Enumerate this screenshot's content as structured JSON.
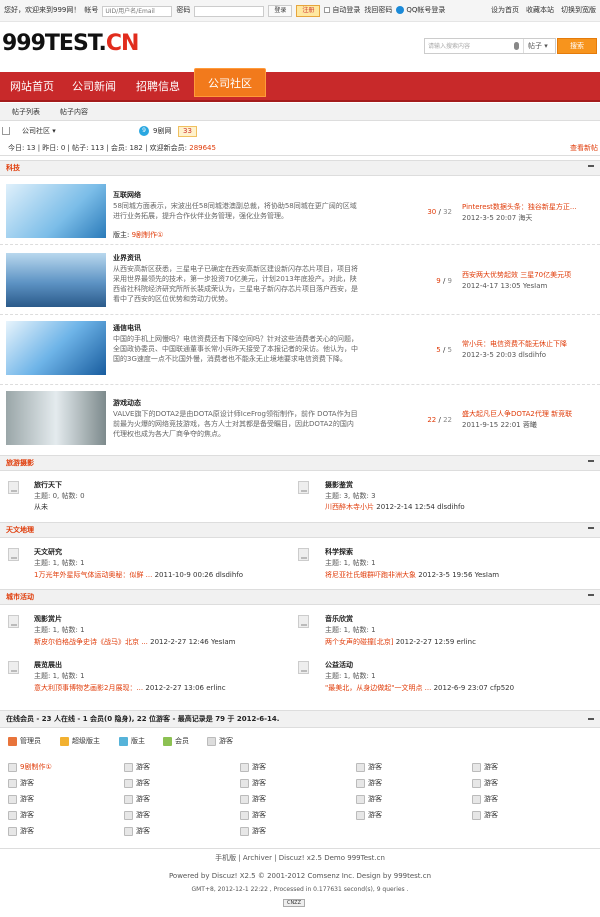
{
  "topbar": {
    "greeting": "您好，欢迎来到999网！",
    "acct_label": "帐号",
    "acct_placeholder": "UID/用户名/Email",
    "pwd_label": "密码",
    "login": "登录",
    "register": "注册",
    "auto_login": "自动登录",
    "find_pwd": "找回密码",
    "qq_login": "QQ帐号登录",
    "links": [
      "设为首页",
      "收藏本站",
      "切换到宽版"
    ]
  },
  "logo": {
    "main": "999TEST.",
    "accent": "CN"
  },
  "search": {
    "placeholder": "请输入搜索内容",
    "scope": "帖子",
    "button": "搜索"
  },
  "nav": {
    "items": [
      "网站首页",
      "公司新闻",
      "招聘信息",
      "公司社区"
    ]
  },
  "subnav": {
    "items": [
      "帖子列表",
      "帖子内容"
    ]
  },
  "crumb": {
    "home": "公司社区",
    "group_icon": "9",
    "group": "9剧网",
    "count": "33"
  },
  "stats": {
    "text": "今日: 13 | 昨日: 0 | 帖子: 113 | 会员: 182 | 欢迎新会员: ",
    "new_member": "289645",
    "new_posts": "查看新帖"
  },
  "sections": {
    "tech": "科技",
    "travel": "旅游摄影",
    "astro": "天文地理",
    "city": "城市活动"
  },
  "tech_rows": [
    {
      "title": "互联网络",
      "desc": "58同城方面表示，宋波出任58同城港澳副总裁，将协助58同城在更广阔的区域进行业务拓展，提升合作伙伴业务管理，强化业务管理。",
      "mod_label": "版主: ",
      "mod": "9剧制作①",
      "count_a": "30",
      "count_b": "32",
      "last": "Pinterest数据头条：独谷新星方正...",
      "time": "2012-3-5 20:07 海天"
    },
    {
      "title": "业界资讯",
      "desc": "从西安高新区获悉，三星电子已确定在西安高新区建设新闪存芯片项目，项目将采用世界最领先的技术，第一步投资70亿美元，计划2013年底投产。对此，陕西省社科院经济研究所所长裴成荣认为，三星电子新闪存芯片项目落户西安，是看中了西安的区位优势和劳动力优势。",
      "mod_label": "",
      "mod": "",
      "count_a": "9",
      "count_b": "9",
      "last": "西安两大优势起效 三星70亿美元项",
      "time": "2012-4-17 13:05 YesIam"
    },
    {
      "title": "通信电讯",
      "desc": "中国的手机上网慢吗？电信资费还有下降空间吗？针对这些消费者关心的问题，全国政协委员、中国联通董事长常小兵昨天接受了本报记者的采访。他认为，中国的3G速度一点不比国外慢，消费者也不能永无止境地要求电信资费下降。",
      "mod_label": "",
      "mod": "",
      "count_a": "5",
      "count_b": "5",
      "last": "常小兵：电信资费不能无休止下降",
      "time": "2012-3-5 20:03 dlsdihfo"
    },
    {
      "title": "游戏动态",
      "desc": "VALVE旗下的DOTA2是由DOTA原设计师IceFrog领衔制作，前作 DOTA作为目前最为火爆的网络竞技游戏，各方人士对其都是备受瞩目，因此DOTA2的国内代理权也成为各大厂商争夺的焦点。",
      "mod_label": "",
      "mod": "",
      "count_a": "22",
      "count_b": "22",
      "last": "盛大起凡巨人争DOTA2代理 新竞联",
      "time": "2011-9-15 22:01 蓉曦"
    }
  ],
  "travel": [
    {
      "title": "旅行天下",
      "stat": "主题: 0, 帖数: 0",
      "last": "从未",
      "time": ""
    },
    {
      "title": "摄影鉴赏",
      "stat": "主题: 3, 帖数: 3",
      "last": "川西醉木寺小片",
      "time": "2012-2-14 12:54 dlsdihfo"
    }
  ],
  "astro": [
    {
      "title": "天文研究",
      "stat": "主题: 1, 帖数: 1",
      "last": "1万光年外星际气体运动奥秘：似鲜 ...",
      "time": "2011-10-9 00:26 dlsdihfo"
    },
    {
      "title": "科学探索",
      "stat": "主题: 1, 帖数: 1",
      "last": "将尼亚社氏蛾群吓跑非洲大象",
      "time": "2012-3-5 19:56 YesIam"
    }
  ],
  "city": [
    {
      "title": "观影赏片",
      "stat": "主题: 1, 帖数: 1",
      "last": "斯皮尔伯格战争史诗《战马》北京 ...",
      "time": "2012-2-27 12:46 YesIam"
    },
    {
      "title": "音乐欣赏",
      "stat": "主题: 1, 帖数: 1",
      "last": "两个女声的碰撞[北京]",
      "time": "2012-2-27 12:59 erlinc"
    },
    {
      "title": "展览展出",
      "stat": "主题: 1, 帖数: 1",
      "last": "意大利顶事博物艺画影2月展现：...",
      "time": "2012-2-27 13:06 erlinc"
    },
    {
      "title": "公益活动",
      "stat": "主题: 1, 帖数: 1",
      "last": "\"最美北，从身边做起\"一文明点 ...",
      "time": "2012-6-9 23:07 cfp520"
    }
  ],
  "online": {
    "summary": "在线会员 - 23 人在线 - 1 会员(0 隐身), 22 位游客 - 最高记录是 79 于 2012-6-14.",
    "legend": [
      "管理员",
      "超级版主",
      "版主",
      "会员",
      "游客"
    ],
    "member": "9剧制作①",
    "guest": "游客"
  },
  "footer": {
    "links": "手机版 | Archiver | Discuz! x2.5 Demo 999Test.cn",
    "powered": "Powered by Discuz! X2.5 © 2001-2012 Comsenz Inc. Design by 999test.cn",
    "gmt": "GMT+8, 2012-12-1 22:22 , Processed in 0.177631 second(s), 9 queries .",
    "badge": "CNZZ"
  },
  "colors": {
    "nav": "#c8292a",
    "nav_active": "#f27a1c",
    "accent": "#e03c0a",
    "search_btn": "#f7941d"
  }
}
